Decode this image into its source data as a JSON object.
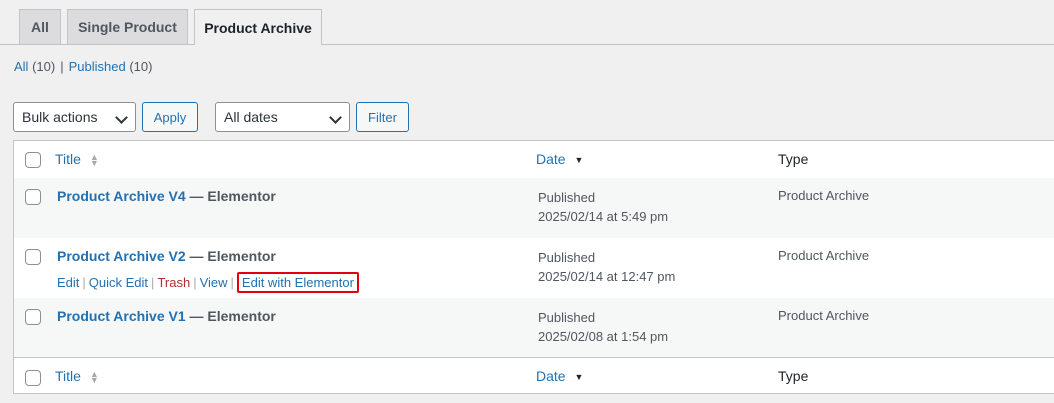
{
  "tabs": [
    {
      "label": "All",
      "active": false
    },
    {
      "label": "Single Product",
      "active": false
    },
    {
      "label": "Product Archive",
      "active": true
    }
  ],
  "status_links": {
    "all_label": "All",
    "all_count": "(10)",
    "separator": "|",
    "published_label": "Published",
    "published_count": "(10)"
  },
  "tablenav": {
    "bulk_actions": "Bulk actions",
    "apply_label": "Apply",
    "dates": "All dates",
    "filter_label": "Filter"
  },
  "columns": {
    "title": "Title",
    "date": "Date",
    "type": "Type"
  },
  "rows": [
    {
      "title": "Product Archive V4",
      "state": "— Elementor",
      "status": "Published",
      "date": "2025/02/14 at 5:49 pm",
      "type": "Product Archive"
    },
    {
      "title": "Product Archive V2",
      "state": "— Elementor",
      "status": "Published",
      "date": "2025/02/14 at 12:47 pm",
      "type": "Product Archive"
    },
    {
      "title": "Product Archive V1",
      "state": "— Elementor",
      "status": "Published",
      "date": "2025/02/08 at 1:54 pm",
      "type": "Product Archive"
    }
  ],
  "row_actions": {
    "edit": "Edit",
    "quick_edit": "Quick Edit",
    "trash": "Trash",
    "view": "View",
    "edit_elementor": "Edit with Elementor",
    "separator": "|"
  },
  "colors": {
    "link": "#2271b1",
    "trash": "#b32d2e",
    "highlight": "#e0000f"
  }
}
